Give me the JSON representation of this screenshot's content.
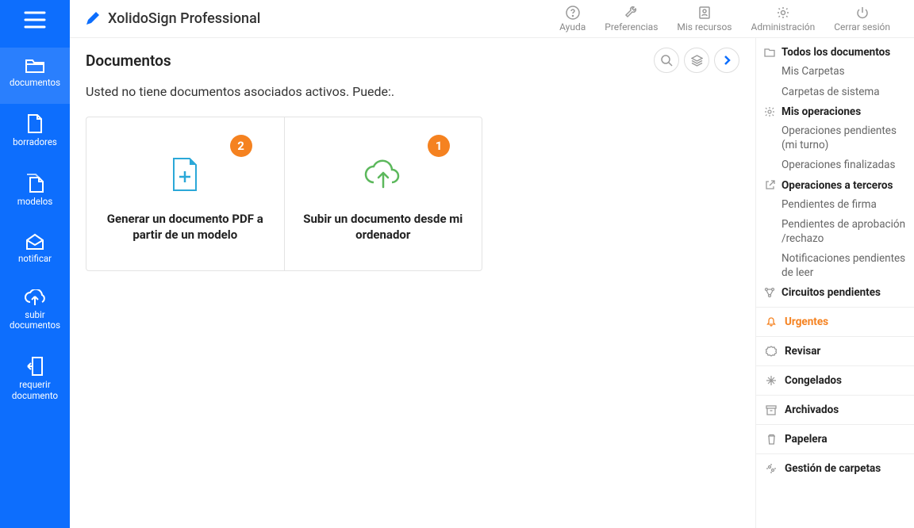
{
  "app": {
    "title": "XolidoSign Professional"
  },
  "header": {
    "ayuda": "Ayuda",
    "preferencias": "Preferencias",
    "recursos": "Mis recursos",
    "admin": "Administración",
    "cerrar": "Cerrar sesión"
  },
  "sidebar": {
    "items": [
      {
        "label": "documentos"
      },
      {
        "label": "borradores"
      },
      {
        "label": "modelos"
      },
      {
        "label": "notificar"
      },
      {
        "label": "subir documentos"
      },
      {
        "label": "requerir documento"
      }
    ]
  },
  "page": {
    "title": "Documentos",
    "empty_msg": "Usted no tiene documentos asociados activos. Puede:."
  },
  "cards": [
    {
      "badge": "2",
      "text": "Generar un documento PDF a partir de un modelo"
    },
    {
      "badge": "1",
      "text": "Subir un documento desde mi ordenador"
    }
  ],
  "right": {
    "todos": "Todos los documentos",
    "mis_carpetas": "Mis Carpetas",
    "carpetas_sistema": "Carpetas de sistema",
    "operaciones": "Mis operaciones",
    "op_pendientes": "Operaciones pendientes (mi turno)",
    "op_finalizadas": "Operaciones finalizadas",
    "terceros": "Operaciones a terceros",
    "pend_firma": "Pendientes de firma",
    "pend_aprob": "Pendientes de aprobación /rechazo",
    "notif": "Notificaciones pendientes de leer",
    "circuitos": "Circuitos pendientes",
    "urgentes": "Urgentes",
    "revisar": "Revisar",
    "congelados": "Congelados",
    "archivados": "Archivados",
    "papelera": "Papelera",
    "gestion": "Gestión de carpetas"
  }
}
